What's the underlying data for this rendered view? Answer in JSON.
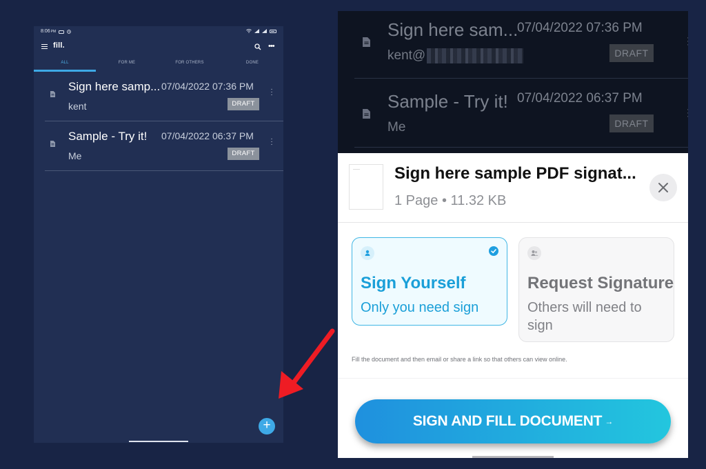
{
  "phone": {
    "status_time": "8:06",
    "status_ampm": "PM",
    "brand": "fill.",
    "tabs": [
      {
        "label": "ALL"
      },
      {
        "label": "FOR ME"
      },
      {
        "label": "FOR OTHERS"
      },
      {
        "label": "DONE"
      }
    ],
    "documents": [
      {
        "title": "Sign here samp...",
        "date": "07/04/2022 07:36 PM",
        "subtitle": "kent",
        "badge": "DRAFT"
      },
      {
        "title": "Sample - Try it!",
        "date": "07/04/2022 06:37 PM",
        "subtitle": "Me",
        "badge": "DRAFT"
      }
    ],
    "fab_label": "+"
  },
  "background_list": {
    "documents": [
      {
        "title": "Sign here sam...",
        "date": "07/04/2022 07:36 PM",
        "subtitle": "kent@",
        "badge": "DRAFT"
      },
      {
        "title": "Sample - Try it!",
        "date": "07/04/2022 06:37 PM",
        "subtitle": "Me",
        "badge": "DRAFT"
      }
    ]
  },
  "sheet": {
    "title": "Sign here sample PDF signat...",
    "meta": "1 Page • 11.32 KB",
    "options": [
      {
        "title": "Sign Yourself",
        "description": "Only you need sign",
        "selected": true
      },
      {
        "title": "Request Signature",
        "description": "Others will need to sign",
        "selected": false
      }
    ],
    "hint": "Fill the document and then email or share a link so that others can view online.",
    "cta_label": "SIGN AND FILL DOCUMENT",
    "cta_arrow": "→"
  },
  "colors": {
    "accent": "#3ea9e6",
    "phone_background": "#212f53",
    "page_background": "#182445",
    "cta_gradient_start": "#1f90de",
    "cta_gradient_end": "#23c6de",
    "annotation_arrow": "#ee1c24"
  },
  "icons": [
    "menu-icon",
    "search-icon",
    "more-vert-icon",
    "document-icon",
    "kebab-icon",
    "plus-icon",
    "close-icon",
    "person-icon",
    "check-circle-icon",
    "arrow-right-icon",
    "annotation-arrow"
  ]
}
